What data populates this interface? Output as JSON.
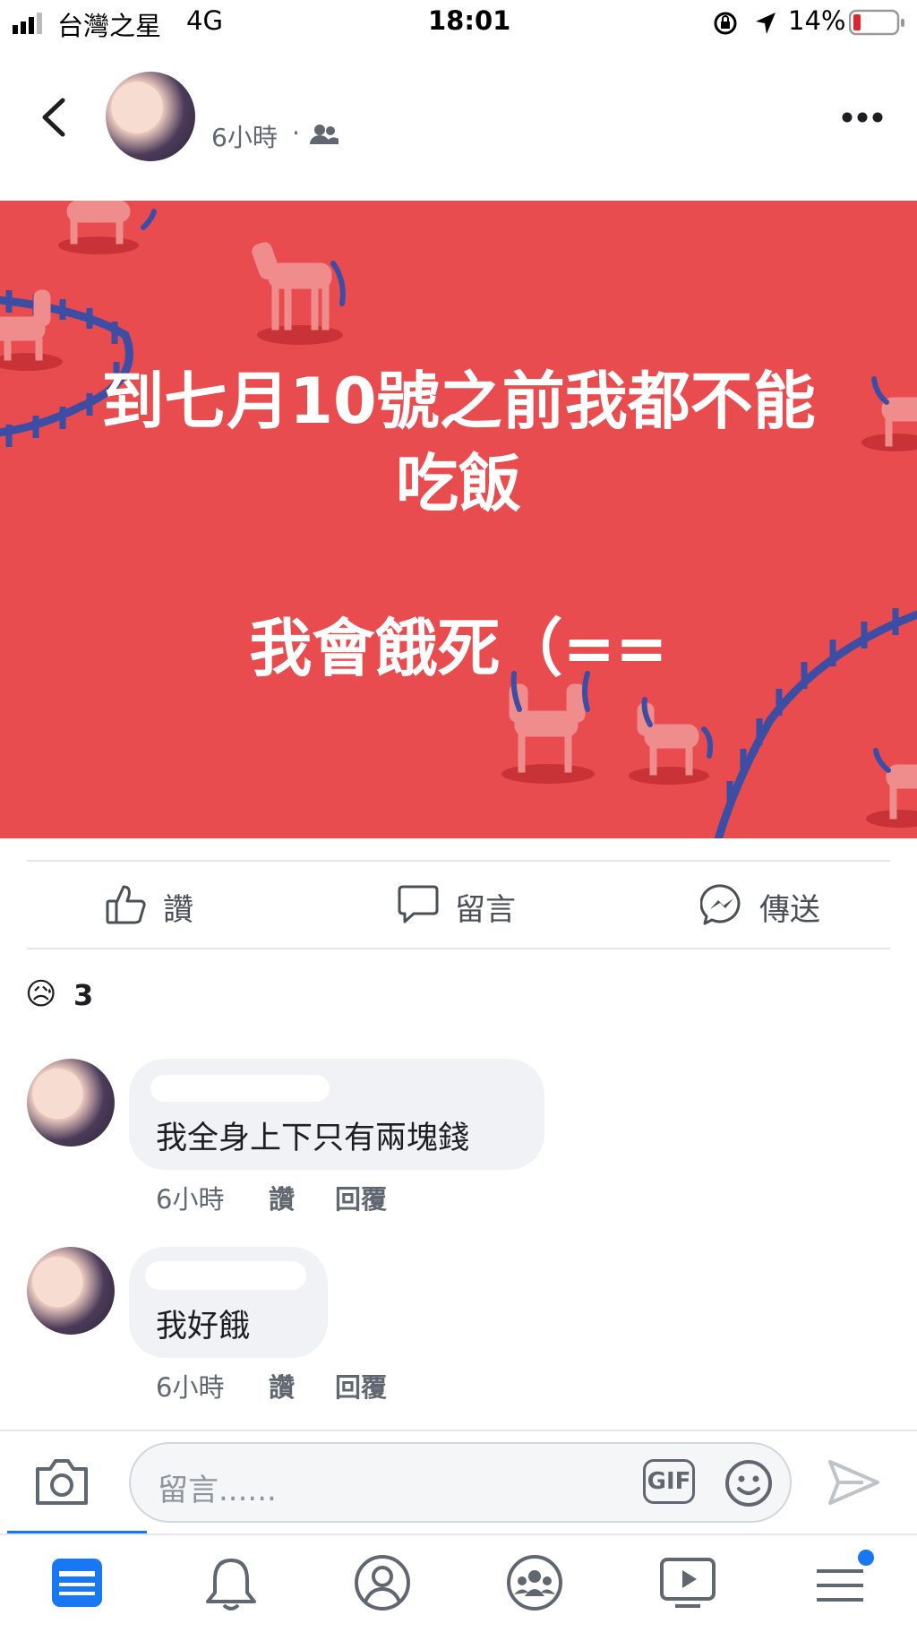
{
  "status_bar": {
    "carrier": "台灣之星",
    "network": "4G",
    "time": "18:01",
    "battery_percent": "14%"
  },
  "header": {
    "post_time": "6小時",
    "separator": "·",
    "audience_icon": "friends-icon",
    "more_icon": "more-dots-icon",
    "back_icon": "chevron-left-icon"
  },
  "post": {
    "text": "到七月10號之前我都不能\n吃飯\n\n我會餓死（==",
    "background_color": "#e84c4f"
  },
  "actions": [
    {
      "label": "讚",
      "icon": "thumbs-up-icon"
    },
    {
      "label": "留言",
      "icon": "comment-icon"
    },
    {
      "label": "傳送",
      "icon": "messenger-icon"
    }
  ],
  "reactions": {
    "emoji": "😥",
    "count": "3"
  },
  "comments": [
    {
      "text": "我全身上下只有兩塊錢",
      "time": "6小時",
      "like_label": "讚",
      "reply_label": "回覆"
    },
    {
      "text": "我好餓",
      "time": "6小時",
      "like_label": "讚",
      "reply_label": "回覆"
    }
  ],
  "composer": {
    "placeholder": "留言......",
    "gif_label": "GIF"
  },
  "colors": {
    "accent": "#1877f2",
    "post_bg": "#e84c4f",
    "fence": "#3d4da3"
  }
}
